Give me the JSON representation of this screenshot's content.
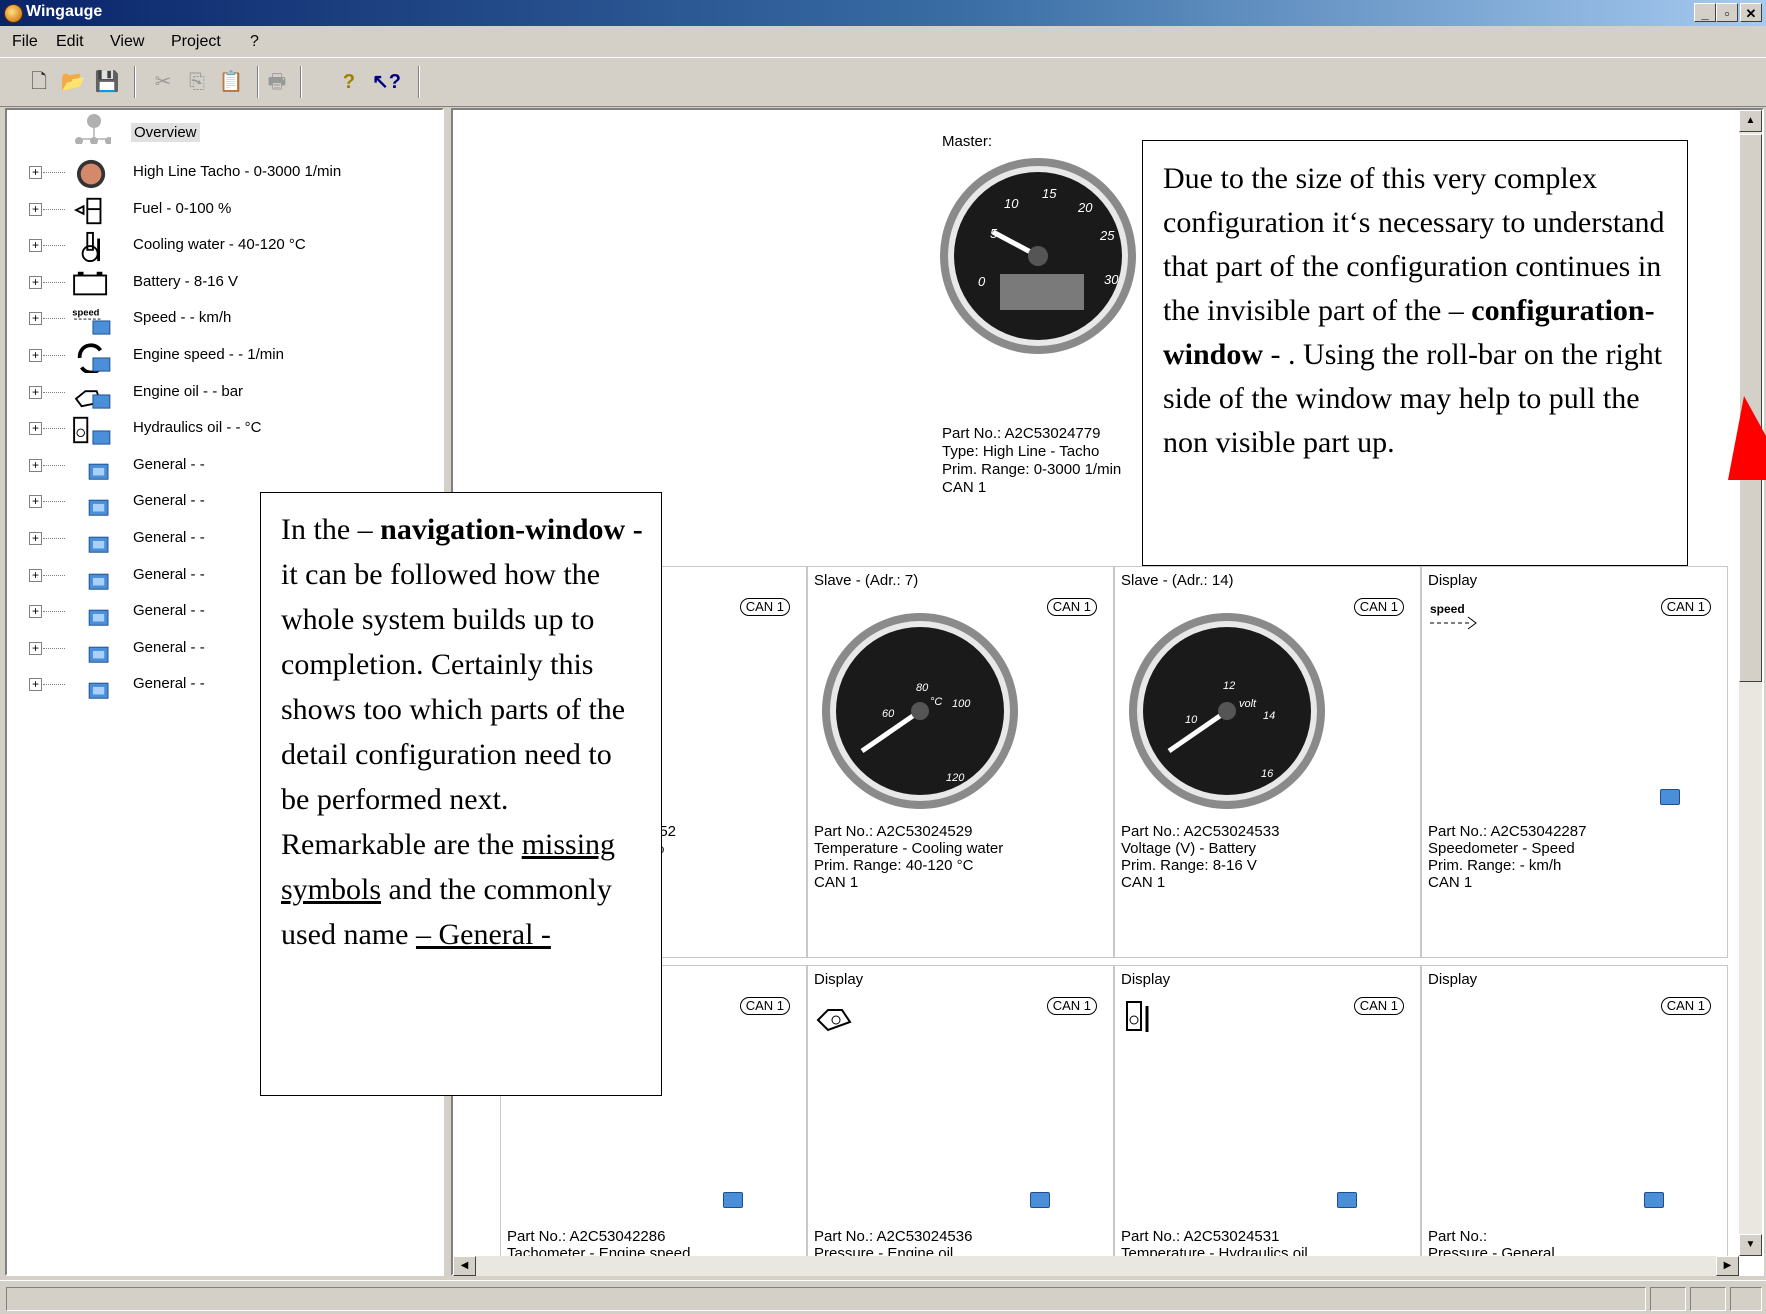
{
  "window": {
    "title": "Wingauge"
  },
  "menu": [
    "File",
    "Edit",
    "View",
    "Project",
    "?"
  ],
  "toolbar_icons": [
    "new-icon",
    "open-icon",
    "save-icon",
    "cut-icon",
    "copy-icon",
    "paste-icon",
    "print-icon",
    "help-icon",
    "context-help-icon"
  ],
  "nav": {
    "root": "Overview",
    "items": [
      {
        "label": "High Line Tacho - 0-3000 1/min",
        "icon": "tacho-gauge-icon"
      },
      {
        "label": "Fuel - 0-100 %",
        "icon": "fuel-icon"
      },
      {
        "label": "Cooling water - 40-120 °C",
        "icon": "temperature-icon"
      },
      {
        "label": "Battery - 8-16 V",
        "icon": "battery-icon"
      },
      {
        "label": "Speed - - km/h",
        "icon": "speed-icon"
      },
      {
        "label": "Engine speed - - 1/min",
        "icon": "engine-speed-icon"
      },
      {
        "label": "Engine oil - - bar",
        "icon": "oil-can-icon"
      },
      {
        "label": "Hydraulics oil - - °C",
        "icon": "hydraulic-oil-icon"
      },
      {
        "label": "General - -",
        "icon": "monitor-icon"
      },
      {
        "label": "General - -",
        "icon": "monitor-icon"
      },
      {
        "label": "General - -",
        "icon": "monitor-icon"
      },
      {
        "label": "General - -",
        "icon": "monitor-icon"
      },
      {
        "label": "General - -",
        "icon": "monitor-icon"
      },
      {
        "label": "General - -",
        "icon": "monitor-icon"
      },
      {
        "label": "General - -",
        "icon": "monitor-icon"
      }
    ]
  },
  "master": {
    "label": "Master:",
    "lines": [
      "Part No.: A2C53024779",
      "Type: High Line - Tacho",
      "Prim. Range: 0-3000 1/min",
      "CAN 1"
    ]
  },
  "cards_row1": [
    {
      "title": "",
      "can": "CAN 1",
      "lines": [
        "552",
        "",
        "%"
      ],
      "kind": "gauge-partial"
    },
    {
      "title": "Slave - (Adr.: 7)",
      "can": "CAN 1",
      "lines": [
        "Part No.: A2C53024529",
        "Temperature - Cooling water",
        "Prim. Range: 40-120 °C",
        "CAN 1"
      ],
      "kind": "gauge-temp"
    },
    {
      "title": "Slave - (Adr.: 14)",
      "can": "CAN 1",
      "lines": [
        "Part No.: A2C53024533",
        "Voltage (V) - Battery",
        "Prim. Range: 8-16 V",
        "CAN 1"
      ],
      "kind": "gauge-volt"
    },
    {
      "title": "Display",
      "can": "CAN 1",
      "lines": [
        "Part No.: A2C53042287",
        "Speedometer - Speed",
        "Prim. Range: - km/h",
        "CAN 1"
      ],
      "kind": "display-speed"
    }
  ],
  "cards_row2": [
    {
      "title": "",
      "can": "CAN 1",
      "lines": [
        "Part No.: A2C53042286",
        "Tachometer - Engine speed"
      ]
    },
    {
      "title": "Display",
      "can": "CAN 1",
      "lines": [
        "Part No.: A2C53024536",
        "Pressure - Engine oil"
      ]
    },
    {
      "title": "Display",
      "can": "CAN 1",
      "lines": [
        "Part No.: A2C53024531",
        "Temperature - Hydraulics oil"
      ]
    },
    {
      "title": "Display",
      "can": "CAN 1",
      "lines": [
        "Part No.:",
        "Pressure - General"
      ]
    }
  ],
  "gauge_labels": {
    "master": [
      "5",
      "10",
      "15",
      "20",
      "25",
      "30",
      "0"
    ],
    "temp": [
      "60",
      "80",
      "100",
      "°C",
      "120"
    ],
    "volt": [
      "10",
      "12",
      "14",
      "16",
      "volt"
    ]
  },
  "speed_icon_text": "speed",
  "callout_nav": {
    "runs": [
      {
        "t": "In the – "
      },
      {
        "t": "navigation-window - ",
        "b": true
      },
      {
        "t": " it can be followed how the whole system builds up to completion. Certainly this shows too which parts of the detail configuration need to be performed next. Remarkable are the "
      },
      {
        "t": "missing symbols",
        "u": true
      },
      {
        "t": " and the commonly used name  "
      },
      {
        "t": "– General  -",
        "u": true
      }
    ]
  },
  "callout_config": {
    "runs": [
      {
        "t": "Due to the size of this very complex configuration it‘s necessary to understand that part of the configuration continues in the invisible part of the – "
      },
      {
        "t": "configuration-window",
        "b": true
      },
      {
        "t": " - . Using the roll-bar on the right side of the window may help to pull the non visible part up."
      }
    ]
  },
  "colors": {
    "arrow": "#ff0000",
    "title_start": "#0a246a",
    "title_end": "#a6caf0"
  }
}
